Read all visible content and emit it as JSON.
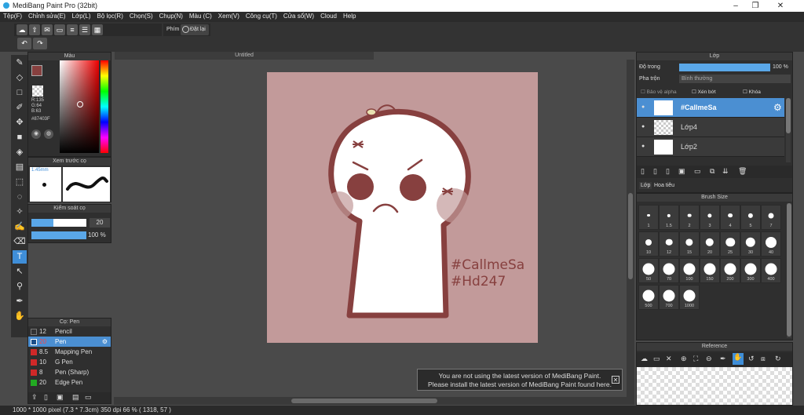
{
  "title": "MediBang Paint Pro (32bit)",
  "menu": [
    "Tệp(F)",
    "Chỉnh sửa(E)",
    "Lớp(L)",
    "Bộ lọc(R)",
    "Chọn(S)",
    "Chụp(N)",
    "Màu (C)",
    "Xem(V)",
    "Công cụ(T)",
    "Cửa sổ(W)",
    "Cloud",
    "Help"
  ],
  "toolbar": {
    "shortcut_label": "Phím",
    "reset_label": "Đặt lại"
  },
  "color_panel": {
    "title": "Màu",
    "r": "R:135",
    "g": "G:64",
    "b": "B:63",
    "hex": "#87403F"
  },
  "brush_preview": {
    "title": "Xem trước cọ",
    "size": "1.45mm"
  },
  "brush_control": {
    "title": "Kiểm soát cọ",
    "size_value": "20",
    "opacity_value": "100 %"
  },
  "pen_panel": {
    "title": "Cọ: Pen",
    "items": [
      {
        "size": "12",
        "name": "Pencil",
        "color": "#333333"
      },
      {
        "size": "20",
        "name": "Pen",
        "color": "#1c4f8a"
      },
      {
        "size": "8.5",
        "name": "Mapping Pen",
        "color": "#d02828"
      },
      {
        "size": "10",
        "name": "G Pen",
        "color": "#d02828"
      },
      {
        "size": "8",
        "name": "Pen (Sharp)",
        "color": "#d02828"
      },
      {
        "size": "20",
        "name": "Edge Pen",
        "color": "#22aa22"
      }
    ]
  },
  "canvas": {
    "tab_title": "Untitled",
    "text1": "#CallmeSa",
    "text2": "#Hd247"
  },
  "notification": {
    "line1": "You are not using the latest version of MediBang Paint.",
    "line2": "Please install the latest version of MediBang Paint found here."
  },
  "layer_panel": {
    "title": "Lớp",
    "opacity_label": "Độ trong",
    "opacity_value": "100 %",
    "opacity_fraction": 1.0,
    "blend_label": "Pha trộn",
    "blend_value": "Bình thường",
    "protect_alpha": "Bảo vệ alpha",
    "clipping": "Xén bớt",
    "lock": "Khóa",
    "layers": [
      {
        "name": "#CallmeSa",
        "selected": true
      },
      {
        "name": "Lớp4",
        "selected": false
      },
      {
        "name": "Lớp2",
        "selected": false
      }
    ],
    "tab_layer": "Lớp",
    "tab_material": "Hoa tiêu"
  },
  "brush_size_panel": {
    "title": "Brush Size",
    "sizes": [
      "1",
      "1.5",
      "2",
      "3",
      "4",
      "5",
      "7",
      "10",
      "12",
      "15",
      "20",
      "25",
      "30",
      "40",
      "50",
      "70",
      "100",
      "150",
      "200",
      "300",
      "400",
      "500",
      "700",
      "1000"
    ]
  },
  "reference_panel": {
    "title": "Reference"
  },
  "status": {
    "text": "1000 * 1000 pixel   (7.3 * 7.3cm)   350 dpi   66 %   ( 1318, 57 )"
  },
  "colors": {
    "accent": "#3f8ed8",
    "art_bg": "#c29a9a",
    "ink": "#87403f"
  }
}
